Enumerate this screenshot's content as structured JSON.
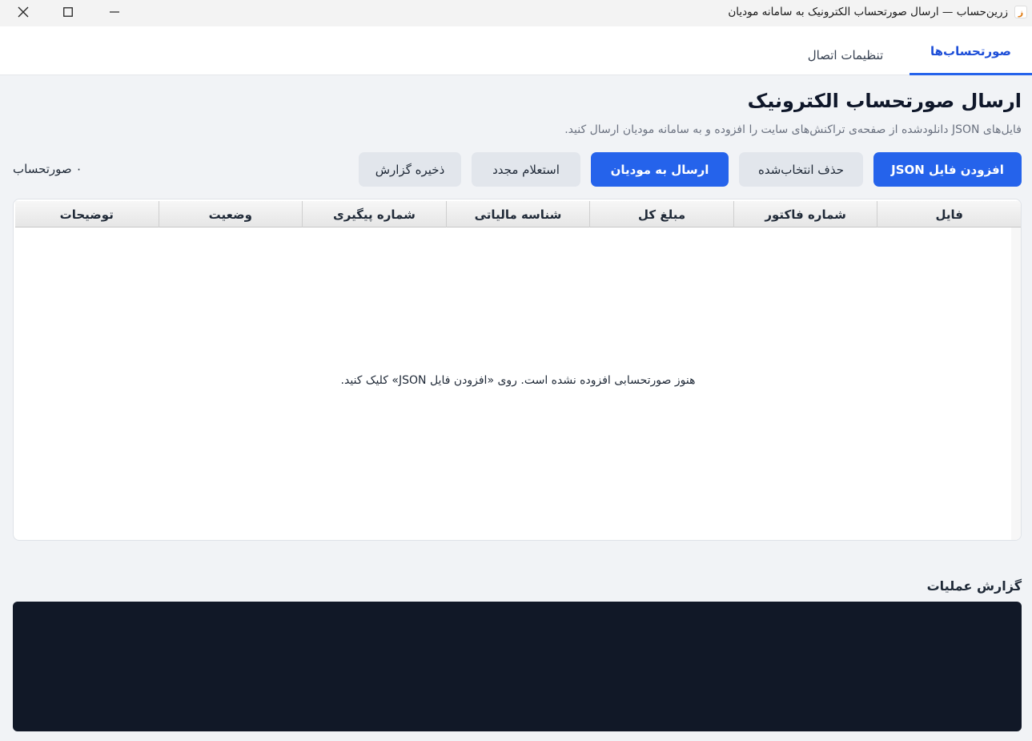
{
  "window": {
    "title": "زرین‌حساب — ارسال صورتحساب الکترونیک به سامانه مودیان",
    "app_icon": "ﺯ"
  },
  "tabs": [
    {
      "label": "صورتحساب‌ها",
      "active": true
    },
    {
      "label": "تنظیمات اتصال",
      "active": false
    }
  ],
  "main": {
    "title": "ارسال صورتحساب الکترونیک",
    "subtitle": "فایل‌های JSON دانلودشده از صفحه‌ی تراکنش‌های سایت را افزوده و به سامانه مودیان ارسال کنید."
  },
  "toolbar": {
    "add_json": "افزودن فایل JSON",
    "delete_selected": "حذف انتخاب‌شده",
    "send_to_moadian": "ارسال به مودیان",
    "requery": "استعلام مجدد",
    "save_report": "ذخیره گزارش",
    "invoice_count": "۰ صورتحساب"
  },
  "table": {
    "columns": [
      "فایل",
      "شماره فاکتور",
      "مبلغ کل",
      "شناسه مالیاتی",
      "شماره پیگیری",
      "وضعیت",
      "توضیحات"
    ],
    "rows": [],
    "empty_message": "هنوز صورتحسابی افزوده نشده است. روی «افزودن فایل JSON» کلیک کنید."
  },
  "log": {
    "title": "گزارش عملیات",
    "content": ""
  },
  "colors": {
    "accent": "#2563eb",
    "log_bg": "#111827"
  }
}
